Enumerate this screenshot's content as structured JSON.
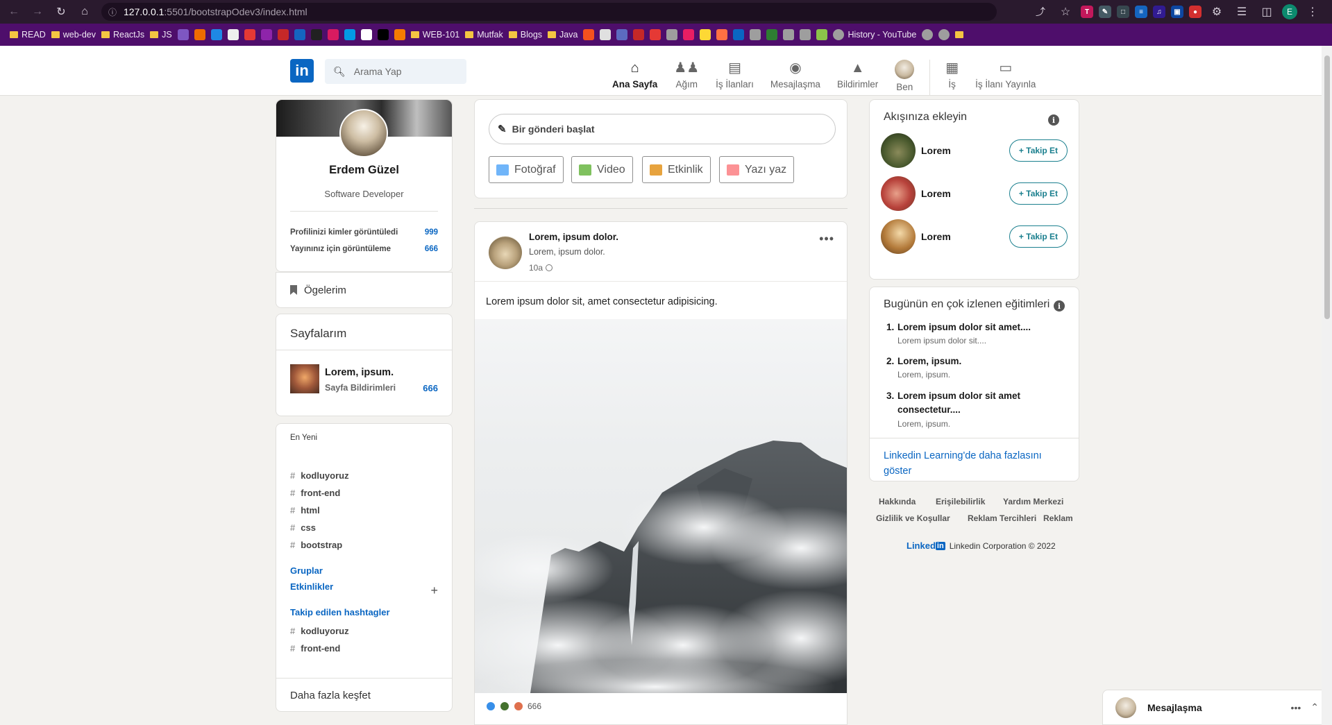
{
  "browser": {
    "url_host": "127.0.0.1",
    "url_path": ":5501/bootstrapOdev3/index.html",
    "profile_initial": "E",
    "bookmarks": [
      "READ",
      "web-dev",
      "ReactJs",
      "JS",
      "WEB-101",
      "Mutfak",
      "Blogs",
      "Java",
      "History - YouTube"
    ]
  },
  "header": {
    "logo": "in",
    "search_placeholder": "Arama Yap",
    "nav": [
      {
        "label": "Ana Sayfa",
        "icon": "home-icon"
      },
      {
        "label": "Ağım",
        "icon": "people-icon"
      },
      {
        "label": "İş İlanları",
        "icon": "briefcase-icon"
      },
      {
        "label": "Mesajlaşma",
        "icon": "chat-icon"
      },
      {
        "label": "Bildirimler",
        "icon": "bell-icon"
      },
      {
        "label": "Ben",
        "icon": "avatar"
      },
      {
        "label": "İş",
        "icon": "grid-icon"
      },
      {
        "label": "İş İlanı Yayınla",
        "icon": "laptop-icon"
      }
    ]
  },
  "profile": {
    "name": "Erdem Güzel",
    "title": "Software Developer",
    "stats": [
      {
        "label": "Profilinizi kimler görüntüledi",
        "value": "999"
      },
      {
        "label": "Yayınınız için görüntüleme",
        "value": "666"
      }
    ]
  },
  "items": {
    "label": "Ögelerim"
  },
  "pages": {
    "title": "Sayfalarım",
    "page_name": "Lorem, ipsum.",
    "page_sub": "Sayfa Bildirimleri",
    "page_count": "666"
  },
  "discover": {
    "recent_label": "En Yeni",
    "hashtags": [
      "kodluyoruz",
      "front-end",
      "html",
      "css",
      "bootstrap"
    ],
    "groups": "Gruplar",
    "events": "Etkinlikler",
    "followed_title": "Takip edilen hashtagler",
    "followed": [
      "kodluyoruz",
      "front-end"
    ],
    "more": "Daha fazla keşfet"
  },
  "composer": {
    "placeholder": "Bir gönderi başlat",
    "buttons": [
      "Fotoğraf",
      "Video",
      "Etkinlik",
      "Yazı yaz"
    ]
  },
  "post": {
    "author": "Lorem, ipsum dolor.",
    "subtitle": "Lorem, ipsum dolor.",
    "time": "10a",
    "text": "Lorem ipsum dolor sit, amet consectetur adipisicing.",
    "reactions": "666"
  },
  "follow": {
    "title": "Akışınıza ekleyin",
    "people": [
      {
        "name": "Lorem",
        "button": "+ Takip Et",
        "color": "#4a5a2e"
      },
      {
        "name": "Lorem",
        "button": "+ Takip Et",
        "color": "#b7413a"
      },
      {
        "name": "Lorem",
        "button": "+ Takip Et",
        "color": "#b37a3a"
      }
    ]
  },
  "courses": {
    "title": "Bugünün en çok izlenen eğitimleri",
    "list": [
      {
        "num": "1.",
        "title": "Lorem ipsum dolor sit amet....",
        "sub": "Lorem ipsum dolor sit...."
      },
      {
        "num": "2.",
        "title": "Lorem, ipsum.",
        "sub": "Lorem, ipsum."
      },
      {
        "num": "3.",
        "title": "Lorem ipsum dolor sit amet consectetur....",
        "sub": "Lorem, ipsum."
      }
    ],
    "more": "Linkedin Learning'de daha fazlasını göster"
  },
  "footer": {
    "links_row1": [
      "Hakkında",
      "Erişilebilirlik",
      "Yardım Merkezi"
    ],
    "links_row2": [
      "Gizlilik ve Koşullar",
      "Reklam Tercihleri",
      "Reklam"
    ],
    "brand_word": "Linked",
    "brand_in": "in",
    "copyright": "Linkedin Corporation © 2022"
  },
  "messaging": {
    "title": "Mesajlaşma"
  },
  "colors": {
    "brand": "#0a66c2",
    "follow": "#1a7f8e",
    "bookmark_bar": "#4e0e6b"
  }
}
